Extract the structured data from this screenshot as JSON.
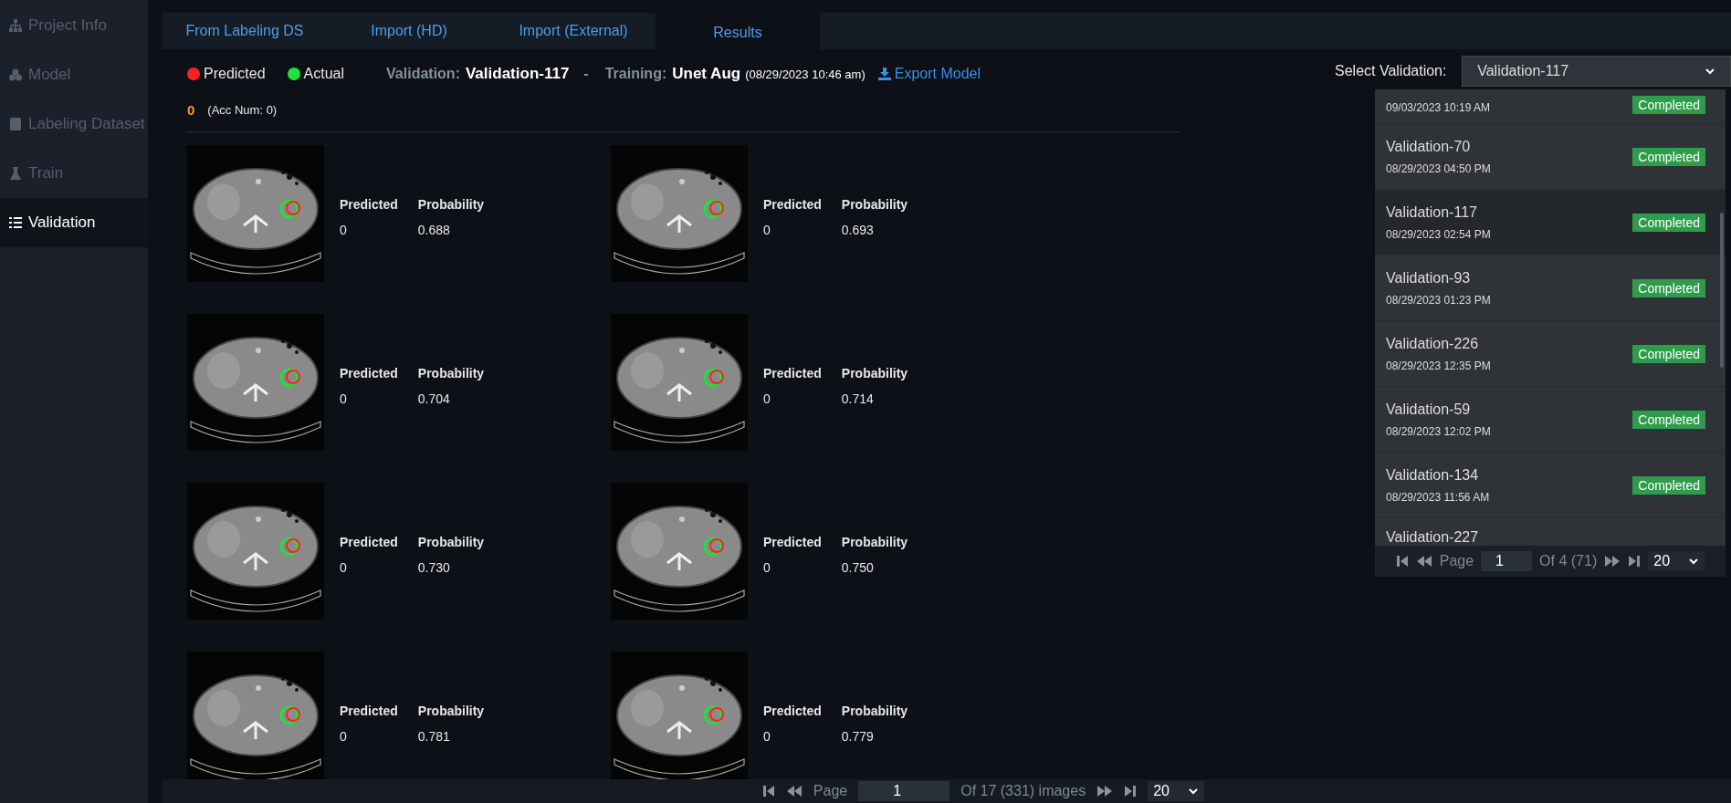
{
  "sidebar": {
    "items": [
      {
        "label": "Project Info",
        "kind": "sitemap",
        "selected": false
      },
      {
        "label": "Model",
        "kind": "cubes",
        "selected": false
      },
      {
        "label": "Labeling Dataset",
        "kind": "book",
        "selected": false
      },
      {
        "label": "Train",
        "kind": "flask",
        "selected": false
      },
      {
        "label": "Validation",
        "kind": "list",
        "selected": true
      }
    ]
  },
  "tabs": [
    {
      "label": "From Labeling DS",
      "selected": false
    },
    {
      "label": "Import (HD)",
      "selected": false
    },
    {
      "label": "Import (External)",
      "selected": false
    },
    {
      "label": "Results",
      "selected": true
    }
  ],
  "legend": [
    {
      "label": "Predicted",
      "color": "#ff2020"
    },
    {
      "label": "Actual",
      "color": "#20e040"
    }
  ],
  "summary": {
    "validation_label": "Validation:",
    "validation": "Validation-117",
    "separator": "-",
    "training_label": "Training:",
    "training": "Unet Aug",
    "training_date": "(08/29/2023 10:46 am)",
    "export": "Export Model"
  },
  "accuracy": {
    "count": "0",
    "note": "(Acc Num: 0)"
  },
  "results": [
    {
      "predicted_label": "Predicted",
      "probability_label": "Probability",
      "predicted": "0",
      "probability": "0.688"
    },
    {
      "predicted_label": "Predicted",
      "probability_label": "Probability",
      "predicted": "0",
      "probability": "0.693"
    },
    {
      "predicted_label": "Predicted",
      "probability_label": "Probability",
      "predicted": "0",
      "probability": "0.704"
    },
    {
      "predicted_label": "Predicted",
      "probability_label": "Probability",
      "predicted": "0",
      "probability": "0.714"
    },
    {
      "predicted_label": "Predicted",
      "probability_label": "Probability",
      "predicted": "0",
      "probability": "0.730"
    },
    {
      "predicted_label": "Predicted",
      "probability_label": "Probability",
      "predicted": "0",
      "probability": "0.750"
    },
    {
      "predicted_label": "Predicted",
      "probability_label": "Probability",
      "predicted": "0",
      "probability": "0.781"
    },
    {
      "predicted_label": "Predicted",
      "probability_label": "Probability",
      "predicted": "0",
      "probability": "0.779"
    }
  ],
  "pager": {
    "label": "Page",
    "page": "1",
    "of": "Of 17 (331) images",
    "page_size": "20"
  },
  "select_validation": {
    "label": "Select Validation:",
    "value": "Validation-117",
    "options": [
      {
        "date": "09/03/2023 10:19 AM",
        "status": "Completed",
        "selected": false
      },
      {
        "name": "Validation-70",
        "date": "08/29/2023 04:50 PM",
        "status": "Completed",
        "selected": false
      },
      {
        "name": "Validation-117",
        "date": "08/29/2023 02:54 PM",
        "status": "Completed",
        "selected": true
      },
      {
        "name": "Validation-93",
        "date": "08/29/2023 01:23 PM",
        "status": "Completed",
        "selected": false
      },
      {
        "name": "Validation-226",
        "date": "08/29/2023 12:35 PM",
        "status": "Completed",
        "selected": false
      },
      {
        "name": "Validation-59",
        "date": "08/29/2023 12:02 PM",
        "status": "Completed",
        "selected": false
      },
      {
        "name": "Validation-134",
        "date": "08/29/2023 11:56 AM",
        "status": "Completed",
        "selected": false
      },
      {
        "name": "Validation-227",
        "selected": false
      }
    ],
    "pager": {
      "label": "Page",
      "page": "1",
      "of": "Of 4 (71)",
      "page_size": "20"
    }
  }
}
